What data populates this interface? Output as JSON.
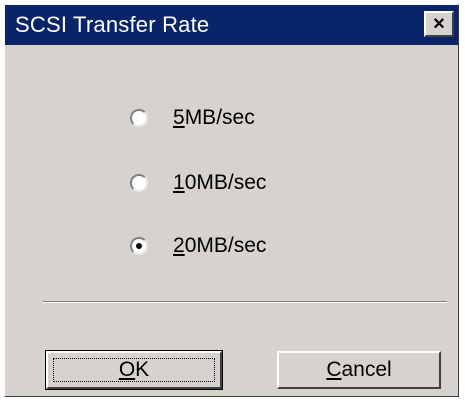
{
  "dialog": {
    "title": "SCSI Transfer Rate",
    "close_glyph": "×"
  },
  "options": [
    {
      "mnemonic": "5",
      "rest": "MB/sec",
      "selected": false
    },
    {
      "mnemonic": "1",
      "rest": "0MB/sec",
      "selected": false
    },
    {
      "mnemonic": "2",
      "rest": "0MB/sec",
      "selected": true
    }
  ],
  "buttons": {
    "ok": {
      "mnemonic": "O",
      "rest": "K"
    },
    "cancel": {
      "mnemonic": "C",
      "rest": "ancel"
    }
  },
  "colors": {
    "titlebar": "#0a246a",
    "face": "#d6d3ce"
  }
}
